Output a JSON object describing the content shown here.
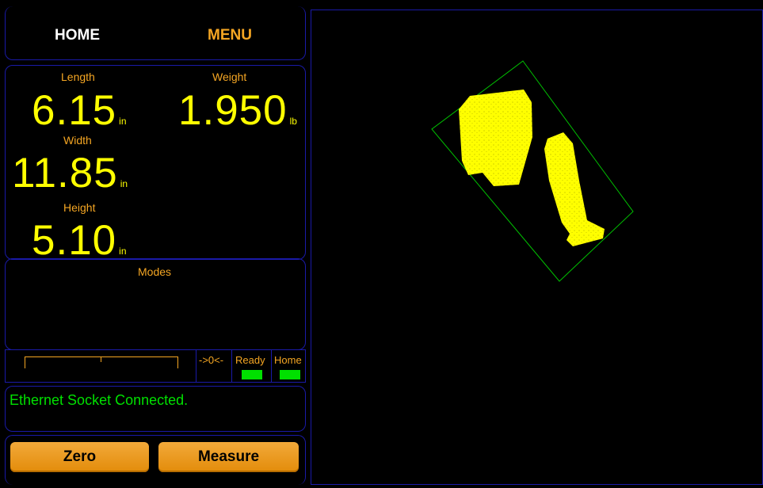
{
  "nav": {
    "home_label": "HOME",
    "menu_label": "MENU"
  },
  "measurements": {
    "length": {
      "label": "Length",
      "value": "6.15",
      "unit": "in"
    },
    "weight": {
      "label": "Weight",
      "value": "1.950",
      "unit": "lb"
    },
    "width": {
      "label": "Width",
      "value": "11.85",
      "unit": "in"
    },
    "height": {
      "label": "Height",
      "value": "5.10",
      "unit": "in"
    }
  },
  "modes": {
    "title": "Modes"
  },
  "status_bar": {
    "zero_label": "->0<-",
    "ready_label": "Ready",
    "home_label": "Home"
  },
  "message": "Ethernet Socket Connected.",
  "actions": {
    "zero_label": "Zero",
    "measure_label": "Measure"
  },
  "colors": {
    "accent": "#f5a623",
    "value": "#ffff00",
    "status_ok": "#00e000",
    "border": "#1a1aa8"
  }
}
